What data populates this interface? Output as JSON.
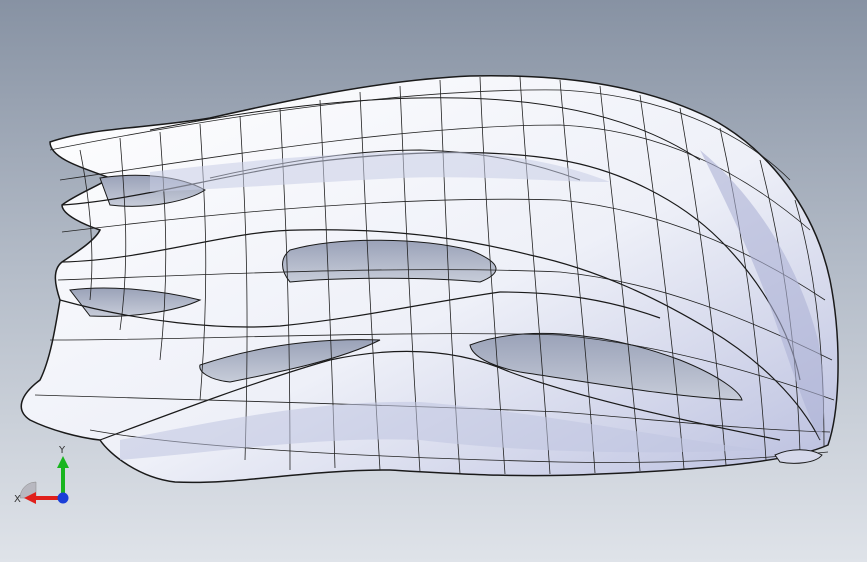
{
  "viewport": {
    "background_top": "#8792a3",
    "background_bottom": "#dfe3e9",
    "model_name": "",
    "model_fill": "#f7f8fc",
    "model_shade": "#aeb3d6",
    "edge_color": "#111111"
  },
  "triad": {
    "icon": "coordinate-triad-icon",
    "x_label": "X",
    "y_label": "Y",
    "x_color": "#e0201b",
    "y_color": "#18b51e",
    "z_color": "#1a3fd8"
  }
}
